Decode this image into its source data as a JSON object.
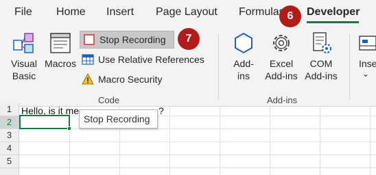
{
  "tabs": [
    {
      "label": "File"
    },
    {
      "label": "Home"
    },
    {
      "label": "Insert"
    },
    {
      "label": "Page Layout"
    },
    {
      "label": "Formulas"
    },
    {
      "label": "Developer"
    }
  ],
  "ribbon": {
    "code_group": {
      "label": "Code",
      "visual_basic_line1": "Visual",
      "visual_basic_line2": "Basic",
      "macros": "Macros",
      "stop_recording": "Stop Recording",
      "use_relative_references": "Use Relative References",
      "macro_security": "Macro Security"
    },
    "addins_group": {
      "label": "Add-ins",
      "addins_line1": "Add-",
      "addins_line2": "ins",
      "excel_addins_line1": "Excel",
      "excel_addins_line2": "Add-ins",
      "com_addins_line1": "COM",
      "com_addins_line2": "Add-ins"
    },
    "insert_partial": "Inse"
  },
  "badges": {
    "developer_step": "6",
    "stop_recording_step": "7"
  },
  "sheet": {
    "rows": [
      "1",
      "2",
      "3",
      "4",
      "5"
    ],
    "a1_text": "Hello, is it me",
    "a1_tail": "?",
    "active_cell": "A2"
  },
  "tooltip": {
    "text": "Stop Recording"
  },
  "colors": {
    "accent_green": "#217346",
    "badge_red": "#b31b1b",
    "icon_blue": "#1f5fbf",
    "record_red": "#c0392b"
  }
}
